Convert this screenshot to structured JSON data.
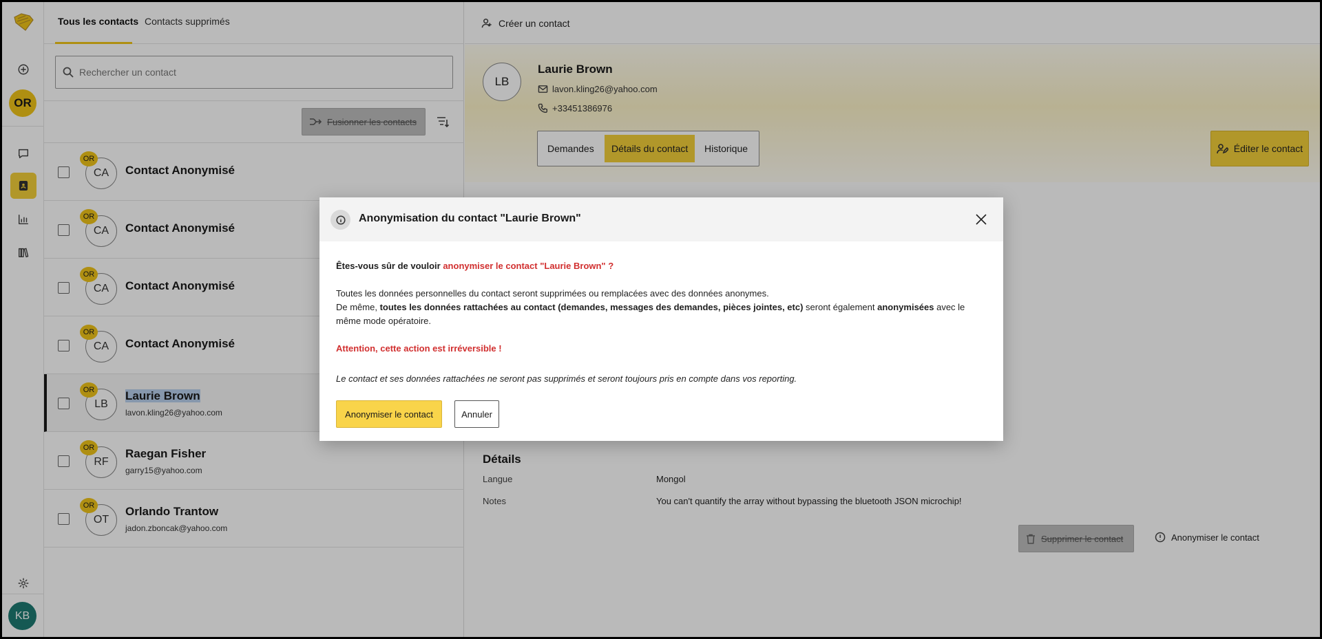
{
  "app": {
    "rail": {
      "org_initials": "OR",
      "user_initials": "KB",
      "icons": [
        "logo-icon",
        "add-circle-icon",
        "chat-icon",
        "contacts-icon",
        "stats-icon",
        "library-icon",
        "settings-icon"
      ]
    },
    "colors": {
      "accent": "#f3cf3a",
      "danger": "#d12f2f",
      "user_avatar": "#1d7a72"
    }
  },
  "contacts_list": {
    "tabs": [
      {
        "label": "Tous les contacts",
        "active": true
      },
      {
        "label": "Contacts supprimés",
        "active": false
      }
    ],
    "search": {
      "placeholder": "Rechercher un contact",
      "value": ""
    },
    "merge_button": "Fusionner les contacts",
    "rows": [
      {
        "badge": "OR",
        "initials": "CA",
        "name": "Contact Anonymisé",
        "email": ""
      },
      {
        "badge": "OR",
        "initials": "CA",
        "name": "Contact Anonymisé",
        "email": ""
      },
      {
        "badge": "OR",
        "initials": "CA",
        "name": "Contact Anonymisé",
        "email": ""
      },
      {
        "badge": "OR",
        "initials": "CA",
        "name": "Contact Anonymisé",
        "email": ""
      },
      {
        "badge": "OR",
        "initials": "LB",
        "name": "Laurie Brown",
        "email": "lavon.kling26@yahoo.com",
        "selected": true
      },
      {
        "badge": "OR",
        "initials": "RF",
        "name": "Raegan Fisher",
        "email": "garry15@yahoo.com"
      },
      {
        "badge": "OR",
        "initials": "OT",
        "name": "Orlando Trantow",
        "email": "jadon.zboncak@yahoo.com"
      }
    ]
  },
  "detail": {
    "create_button": "Créer un contact",
    "contact": {
      "initials": "LB",
      "name": "Laurie Brown",
      "email": "lavon.kling26@yahoo.com",
      "phone": "+33451386976"
    },
    "tabs": [
      {
        "label": "Demandes",
        "active": false
      },
      {
        "label": "Détails du contact",
        "active": true
      },
      {
        "label": "Historique",
        "active": false
      }
    ],
    "edit_button": "Éditer le contact",
    "details_title": "Détails",
    "fields": [
      {
        "label": "Langue",
        "value": "Mongol"
      },
      {
        "label": "Notes",
        "value": "You can't quantify the array without bypassing the bluetooth JSON microchip!"
      }
    ],
    "delete_button": "Supprimer le contact",
    "anonymize_link": "Anonymiser le contact"
  },
  "modal": {
    "title": "Anonymisation du contact \"Laurie Brown\"",
    "question_prefix": "Êtes-vous sûr de vouloir ",
    "question_highlight": "anonymiser le contact \"Laurie Brown\" ?",
    "para1_line1": "Toutes les données personnelles du contact seront supprimées ou remplacées avec des données anonymes.",
    "para1_line2_a": "De même, ",
    "para1_line2_b": "toutes les données rattachées au contact (demandes, messages des demandes, pièces jointes, etc)",
    "para1_line2_c": " seront également ",
    "para1_line2_d": "anonymisées",
    "para1_line2_e": " avec le même mode opératoire.",
    "warning": "Attention, cette action est irréversible !",
    "note": "Le contact et ses données rattachées ne seront pas supprimés et seront toujours pris en compte dans vos reporting.",
    "confirm_button": "Anonymiser le contact",
    "cancel_button": "Annuler"
  }
}
